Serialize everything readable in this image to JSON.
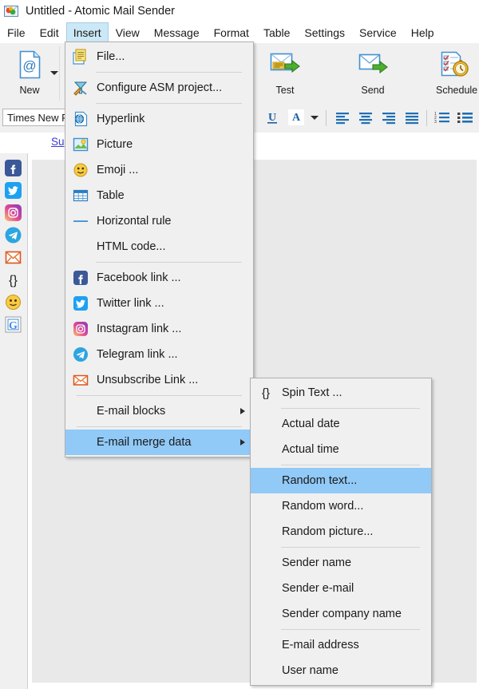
{
  "window": {
    "title": "Untitled - Atomic Mail Sender",
    "app_icon": "atomic-mail-sender-icon"
  },
  "menubar": {
    "items": [
      {
        "label": "File",
        "active": false
      },
      {
        "label": "Edit",
        "active": false
      },
      {
        "label": "Insert",
        "active": true
      },
      {
        "label": "View",
        "active": false
      },
      {
        "label": "Message",
        "active": false
      },
      {
        "label": "Format",
        "active": false
      },
      {
        "label": "Table",
        "active": false
      },
      {
        "label": "Settings",
        "active": false
      },
      {
        "label": "Service",
        "active": false
      },
      {
        "label": "Help",
        "active": false
      }
    ]
  },
  "ribbon": {
    "buttons": [
      {
        "label": "New",
        "icon": "new-document-at-icon",
        "has_dropdown": true
      },
      {
        "label": "Test",
        "icon": "test-send-envelope-icon",
        "has_dropdown": false
      },
      {
        "label": "Send",
        "icon": "send-envelope-icon",
        "has_dropdown": false
      },
      {
        "label": "Schedule",
        "icon": "schedule-clock-icon",
        "has_dropdown": false
      }
    ]
  },
  "formatbar": {
    "font_name": "Times New R",
    "buttons": [
      {
        "icon": "underline-icon",
        "label": "U"
      },
      {
        "icon": "font-color-icon",
        "label": "A"
      },
      {
        "icon": "align-left-icon"
      },
      {
        "icon": "align-center-icon"
      },
      {
        "icon": "align-right-icon"
      },
      {
        "icon": "align-justify-icon"
      },
      {
        "icon": "numbered-list-icon"
      },
      {
        "icon": "bulleted-list-icon"
      }
    ]
  },
  "subject": {
    "link_label": "Su"
  },
  "sidebar": {
    "items": [
      {
        "icon": "facebook-icon"
      },
      {
        "icon": "twitter-icon"
      },
      {
        "icon": "instagram-icon"
      },
      {
        "icon": "telegram-icon"
      },
      {
        "icon": "unsubscribe-envelope-icon"
      },
      {
        "icon": "braces-icon",
        "label": "{}"
      },
      {
        "icon": "emoji-smiley-icon"
      },
      {
        "icon": "google-icon",
        "label": "G"
      }
    ]
  },
  "insert_menu": {
    "items": [
      {
        "type": "item",
        "label": "File...",
        "icon": "file-document-icon"
      },
      {
        "type": "separator"
      },
      {
        "type": "item",
        "label": "Configure ASM project...",
        "icon": "configure-asm-icon"
      },
      {
        "type": "separator"
      },
      {
        "type": "item",
        "label": "Hyperlink",
        "icon": "hyperlink-globe-icon"
      },
      {
        "type": "item",
        "label": "Picture",
        "icon": "picture-icon"
      },
      {
        "type": "item",
        "label": "Emoji ...",
        "icon": "emoji-smiley-icon"
      },
      {
        "type": "item",
        "label": "Table",
        "icon": "table-grid-icon"
      },
      {
        "type": "item",
        "label": "Horizontal rule",
        "icon": "horizontal-rule-icon"
      },
      {
        "type": "item",
        "label": "HTML code...",
        "icon": null
      },
      {
        "type": "separator"
      },
      {
        "type": "item",
        "label": "Facebook link ...",
        "icon": "facebook-icon"
      },
      {
        "type": "item",
        "label": "Twitter link ...",
        "icon": "twitter-icon"
      },
      {
        "type": "item",
        "label": "Instagram link ...",
        "icon": "instagram-icon"
      },
      {
        "type": "item",
        "label": "Telegram link ...",
        "icon": "telegram-icon"
      },
      {
        "type": "item",
        "label": "Unsubscribe Link ...",
        "icon": "unsubscribe-envelope-icon"
      },
      {
        "type": "separator"
      },
      {
        "type": "item",
        "label": "E-mail blocks",
        "icon": null,
        "submenu": true
      },
      {
        "type": "separator"
      },
      {
        "type": "item",
        "label": "E-mail merge data",
        "icon": null,
        "submenu": true,
        "highlighted": true
      }
    ]
  },
  "merge_menu": {
    "items": [
      {
        "type": "item",
        "label": "Spin Text ...",
        "icon": "braces-icon"
      },
      {
        "type": "separator"
      },
      {
        "type": "item",
        "label": "Actual date",
        "icon": null
      },
      {
        "type": "item",
        "label": "Actual time",
        "icon": null
      },
      {
        "type": "separator"
      },
      {
        "type": "item",
        "label": "Random text...",
        "icon": null,
        "highlighted": true
      },
      {
        "type": "item",
        "label": "Random word...",
        "icon": null
      },
      {
        "type": "item",
        "label": "Random picture...",
        "icon": null
      },
      {
        "type": "separator"
      },
      {
        "type": "item",
        "label": "Sender name",
        "icon": null
      },
      {
        "type": "item",
        "label": "Sender e-mail",
        "icon": null
      },
      {
        "type": "item",
        "label": "Sender company name",
        "icon": null
      },
      {
        "type": "separator"
      },
      {
        "type": "item",
        "label": "E-mail address",
        "icon": null
      },
      {
        "type": "item",
        "label": "User name",
        "icon": null
      }
    ]
  },
  "colors": {
    "highlight": "#91c9f7",
    "menu_bg": "#f0f0f0",
    "active_tab": "#cce8f6",
    "link": "#3a3ad0",
    "canvas": "#e9e9e9"
  }
}
